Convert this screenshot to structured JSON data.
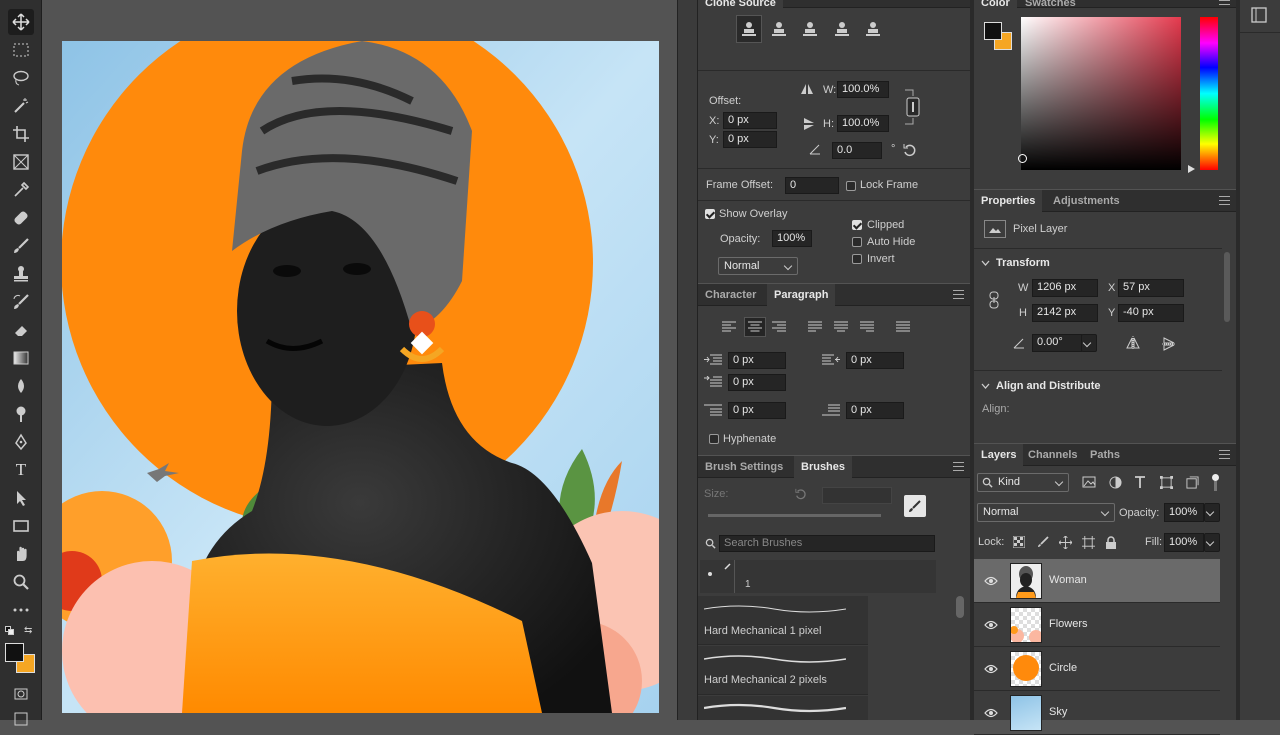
{
  "toolbar": {
    "tools": [
      "move-icon",
      "marquee-icon",
      "lasso-icon",
      "magic-wand-icon",
      "crop-icon",
      "frame-icon",
      "eyedropper-icon",
      "healing-icon",
      "brush-icon",
      "stamp-icon",
      "history-brush-icon",
      "eraser-icon",
      "gradient-icon",
      "blur-icon",
      "dodge-icon",
      "pen-icon",
      "type-icon",
      "path-select-icon",
      "shape-icon",
      "hand-icon",
      "zoom-icon",
      "more-icon"
    ],
    "type_glyph": "T",
    "foreground_color": "#111111",
    "background_color": "#f5a623"
  },
  "clone_source": {
    "tab": "Clone Source",
    "offset_label": "Offset:",
    "x_label": "X:",
    "x_value": "0 px",
    "y_label": "Y:",
    "y_value": "0 px",
    "w_label": "W:",
    "w_value": "100.0%",
    "h_label": "H:",
    "h_value": "100.0%",
    "angle_value": "0.0",
    "degree": "°",
    "frame_offset_label": "Frame Offset:",
    "frame_offset_value": "0",
    "lock_frame": "Lock Frame",
    "show_overlay": "Show Overlay",
    "opacity_label": "Opacity:",
    "opacity_value": "100%",
    "blend_mode": "Normal",
    "clipped": "Clipped",
    "auto_hide": "Auto Hide",
    "invert": "Invert"
  },
  "color_panel": {
    "tabs": [
      "Color",
      "Swatches"
    ],
    "foreground": "#111111",
    "background": "#f5a623",
    "hue_color": "#e53a4e"
  },
  "char_para": {
    "tabs": [
      "Character",
      "Paragraph"
    ],
    "indent_left": "0 px",
    "indent_right": "0 px",
    "first_line": "0 px",
    "space_before": "0 px",
    "space_after": "0 px",
    "hyphenate": "Hyphenate"
  },
  "brushes": {
    "tabs": [
      "Brush Settings",
      "Brushes"
    ],
    "size_label": "Size:",
    "search_placeholder": "Search Brushes",
    "brush_size_num": "1",
    "items": [
      "Hard Mechanical 1 pixel",
      "Hard Mechanical 2 pixels"
    ]
  },
  "properties": {
    "tabs": [
      "Properties",
      "Adjustments"
    ],
    "layer_type": "Pixel Layer",
    "transform_title": "Transform",
    "w_label": "W",
    "w_value": "1206 px",
    "x_label": "X",
    "x_value": "57 px",
    "h_label": "H",
    "h_value": "2142 px",
    "y_label": "Y",
    "y_value": "-40 px",
    "angle_value": "0.00°",
    "align_title": "Align and Distribute",
    "align_label": "Align:"
  },
  "layers": {
    "tabs": [
      "Layers",
      "Channels",
      "Paths"
    ],
    "filter_kind": "Kind",
    "blend_mode": "Normal",
    "opacity_label": "Opacity:",
    "opacity_value": "100%",
    "lock_label": "Lock:",
    "fill_label": "Fill:",
    "fill_value": "100%",
    "rows": [
      "Woman",
      "Flowers",
      "Circle",
      "Sky"
    ]
  }
}
